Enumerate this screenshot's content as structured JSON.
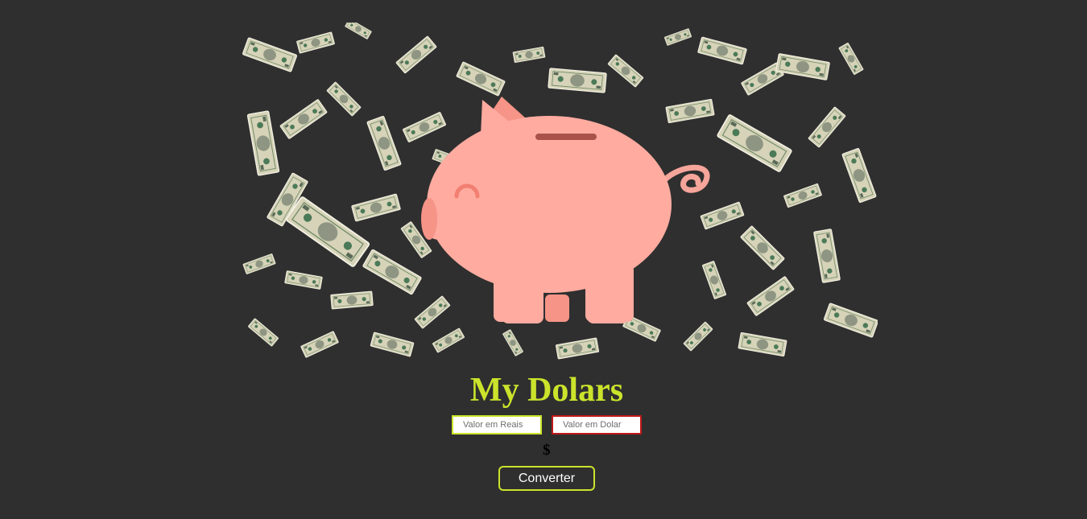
{
  "colors": {
    "background": "#2f2f2f",
    "title": "#cbe32b",
    "reais_border": "#cbe32b",
    "dolar_border": "#c01818",
    "button_border": "#cbe32b",
    "pig": "#ffaba0",
    "pig_shade": "#f28c80",
    "bill": "#d9d6bd"
  },
  "hero": {
    "image": "piggy-bank-with-flying-dollar-bills"
  },
  "page": {
    "title": "My Dolars"
  },
  "form": {
    "reais_placeholder": "Valor em Reais",
    "dolar_placeholder": "Valor em Dolar",
    "result_text": "$",
    "convert_label": "Converter"
  }
}
